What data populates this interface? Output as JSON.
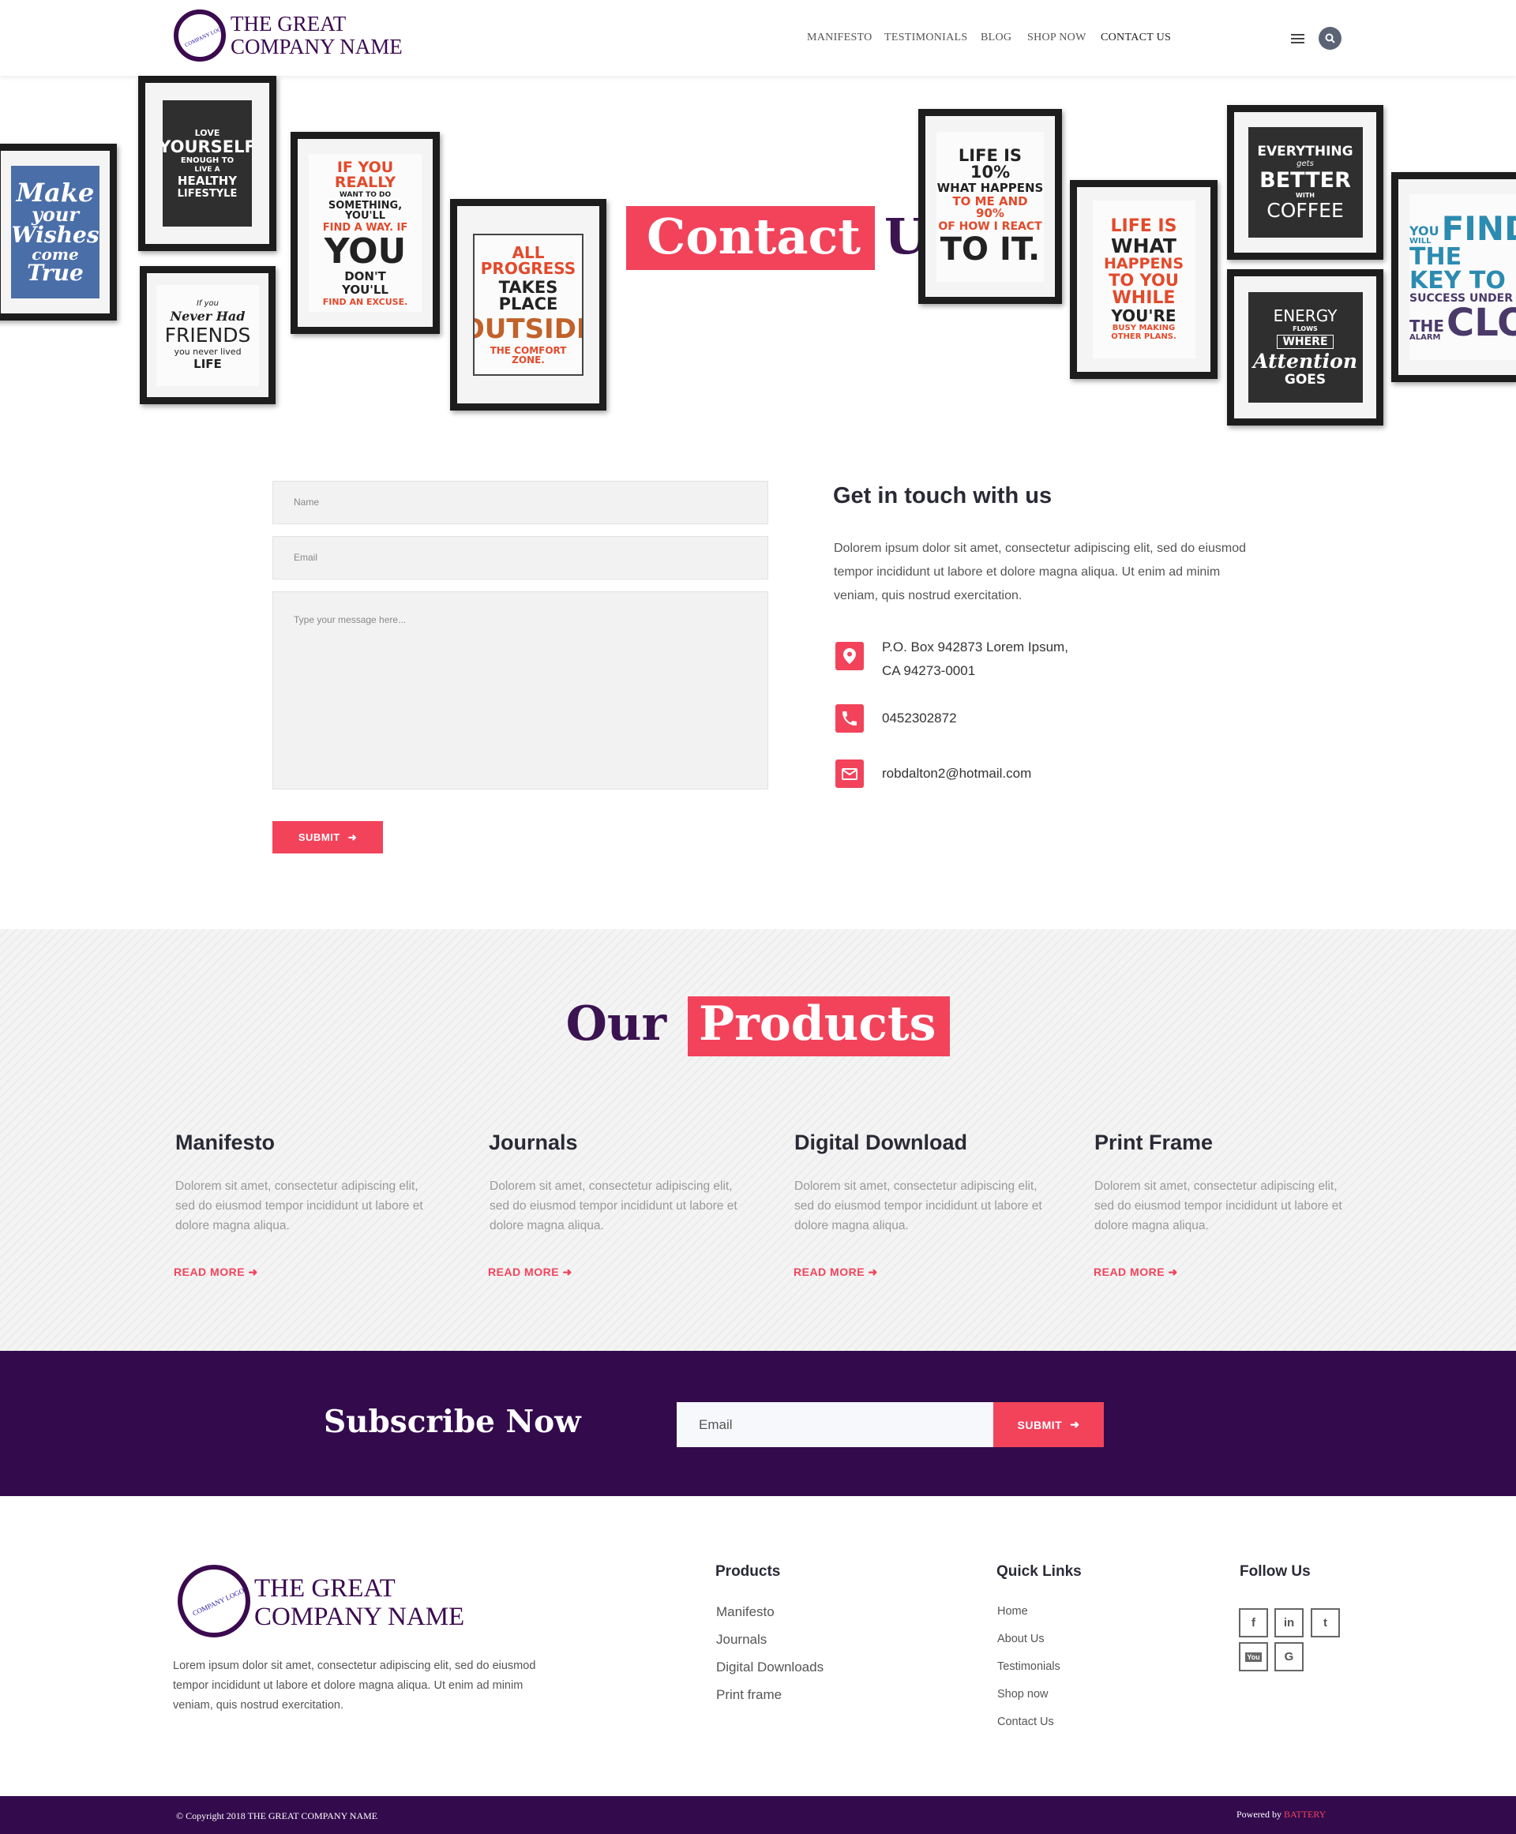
{
  "header": {
    "logo_small": "COMPANY LOGO",
    "logo_line1": "THE GREAT",
    "logo_line2": "COMPANY NAME",
    "nav": [
      "MANIFESTO",
      "TESTIMONIALS",
      "BLOG",
      "SHOP NOW",
      "CONTACT US"
    ],
    "active_nav": "CONTACT US"
  },
  "hero": {
    "title_highlight": "Contact",
    "title_plain": "Us",
    "posters": {
      "p1": [
        "Make",
        "your",
        "Wishes",
        "come",
        "True"
      ],
      "p2": [
        "LOVE",
        "YOURSELF",
        "ENOUGH TO",
        "LIVE A",
        "HEALTHY",
        "LIFESTYLE"
      ],
      "p3": [
        "If you",
        "Never Had",
        "FRIENDS",
        "you never lived",
        "LIFE"
      ],
      "p4": [
        "IF YOU REALLY",
        "WANT TO DO",
        "SOMETHING, YOU'LL",
        "FIND A WAY. IF",
        "YOU",
        "DON'T",
        "YOU'LL",
        "FIND AN EXCUSE."
      ],
      "p5": [
        "ALL PROGRESS",
        "TAKES PLACE",
        "OUTSIDE",
        "THE COMFORT ZONE."
      ],
      "p6": [
        "LIFE IS 10%",
        "WHAT HAPPENS",
        "TO ME AND 90%",
        "OF HOW I REACT",
        "TO IT."
      ],
      "p7": [
        "LIFE IS",
        "WHAT",
        "HAPPENS",
        "TO YOU",
        "WHILE",
        "YOU'RE",
        "BUSY MAKING",
        "OTHER PLANS."
      ],
      "p8": [
        "EVERYTHING",
        "gets",
        "BETTER",
        "WITH",
        "COFFEE"
      ],
      "p9": [
        "ENERGY",
        "FLOWS",
        "WHERE",
        "Attention",
        "GOES"
      ],
      "p10": [
        "YOU",
        "WILL",
        "FIND",
        "THE KEY TO",
        "SUCCESS UNDER",
        "THE",
        "ALARM",
        "CLOCK"
      ]
    }
  },
  "contact_form": {
    "name_placeholder": "Name",
    "email_placeholder": "Email",
    "message_placeholder": "Type your message here...",
    "submit_label": "SUBMIT"
  },
  "contact_info": {
    "title": "Get in touch with us",
    "description": "Dolorem ipsum dolor sit amet, consectetur adipiscing elit, sed do eiusmod tempor incididunt ut labore et  dolore magna aliqua. Ut enim ad minim veniam, quis nostrud exercitation.",
    "address_line1": "P.O. Box 942873 Lorem Ipsum,",
    "address_line2": "CA 94273-0001",
    "phone": "0452302872",
    "email": "robdalton2@hotmail.com"
  },
  "products": {
    "title_plain": "Our",
    "title_highlight": "Products",
    "items": [
      {
        "name": "Manifesto",
        "desc": "Dolorem sit amet, consectetur adipiscing elit, sed do eiusmod tempor incididunt ut labore et dolore magna aliqua.",
        "link": "READ MORE"
      },
      {
        "name": "Journals",
        "desc": "Dolorem sit amet, consectetur adipiscing elit, sed do eiusmod tempor incididunt ut labore et dolore magna aliqua.",
        "link": "READ MORE"
      },
      {
        "name": "Digital Download",
        "desc": "Dolorem sit amet, consectetur adipiscing elit, sed do eiusmod tempor incididunt ut labore et dolore magna aliqua.",
        "link": "READ MORE"
      },
      {
        "name": "Print Frame",
        "desc": "Dolorem sit amet, consectetur adipiscing elit, sed do eiusmod tempor incididunt ut labore et dolore magna aliqua.",
        "link": "READ MORE"
      }
    ]
  },
  "subscribe": {
    "title": "Subscribe Now",
    "email_placeholder": "Email",
    "submit_label": "SUBMIT"
  },
  "footer": {
    "logo_small": "COMPANY LOGO",
    "logo_line1": "THE GREAT",
    "logo_line2": "COMPANY NAME",
    "description": "Lorem ipsum dolor sit amet, consectetur adipiscing elit, sed do eiusmod tempor incididunt ut labore et dolore magna aliqua. Ut enim ad minim veniam, quis nostrud exercitation.",
    "products_heading": "Products",
    "products_links": [
      "Manifesto",
      "Journals",
      "Digital Downloads",
      "Print frame"
    ],
    "quick_heading": "Quick Links",
    "quick_links": [
      "Home",
      "About Us",
      "Testimonials",
      "Shop now",
      "Contact Us"
    ],
    "follow_heading": "Follow Us",
    "social": [
      {
        "icon": "facebook-icon",
        "glyph": "f"
      },
      {
        "icon": "linkedin-icon",
        "glyph": "in"
      },
      {
        "icon": "twitter-icon",
        "glyph": "t"
      },
      {
        "icon": "youtube-icon",
        "glyph": "You"
      },
      {
        "icon": "google-icon",
        "glyph": "G"
      }
    ],
    "copyright": "© Copyright 2018 THE GREAT COMPANY NAME",
    "powered_prefix": "Powered by",
    "powered_brand": "BATTERY"
  },
  "colors": {
    "accent": "#f2435b",
    "brand_dark": "#330b4d",
    "logo_purple": "#3b0a4f"
  }
}
